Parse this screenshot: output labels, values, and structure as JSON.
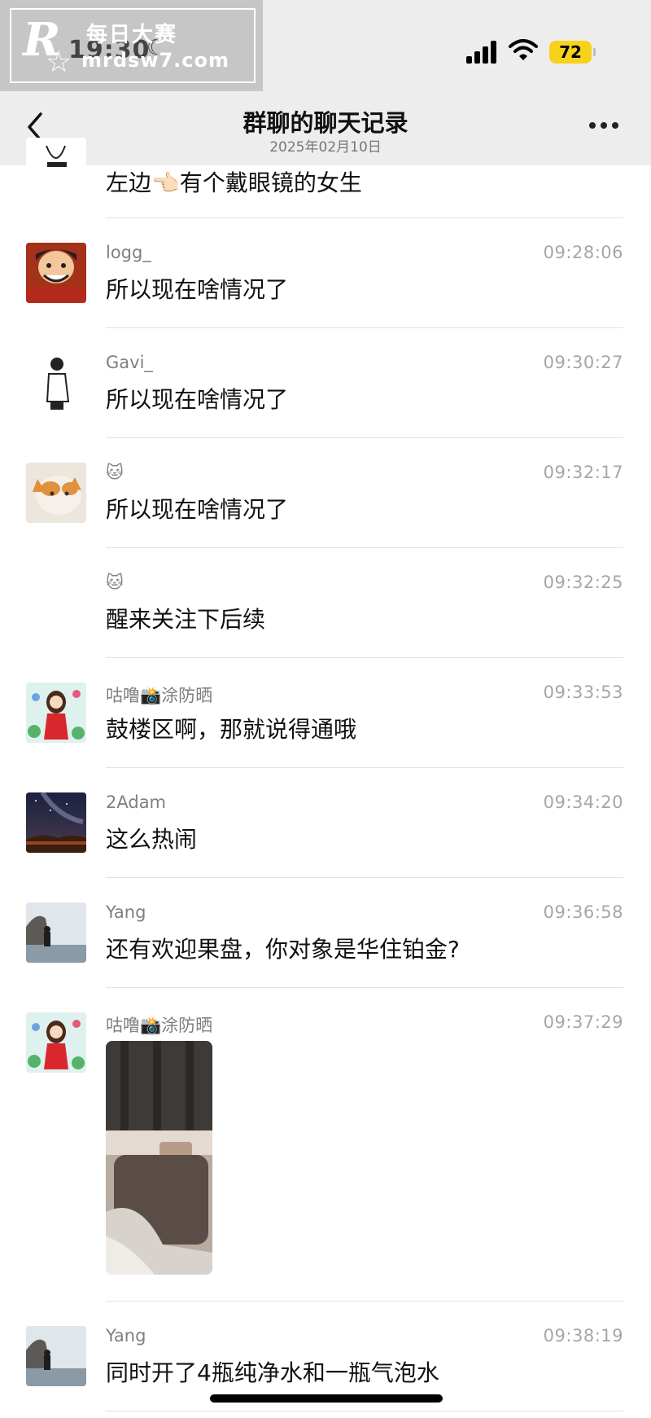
{
  "status_bar": {
    "time": "19:30",
    "battery": "72"
  },
  "header": {
    "title": "群聊的聊天记录",
    "date": "2025年02月10日"
  },
  "watermark": {
    "brand": "R",
    "cn_text": "每日大赛",
    "url": "mrdsw7.com"
  },
  "partial_message": {
    "text": "左边👈🏻有个戴眼镜的女生"
  },
  "messages": [
    {
      "sender": "logg_",
      "time": "09:28:06",
      "text": "所以现在啥情况了"
    },
    {
      "sender": "Gavi_",
      "time": "09:30:27",
      "text": "所以现在啥情况了"
    },
    {
      "sender": "🐱",
      "time": "09:32:17",
      "text": "所以现在啥情况了"
    },
    {
      "sender": "🐱",
      "time": "09:32:25",
      "text": "醒来关注下后续"
    },
    {
      "sender": "咕噜📸涂防晒",
      "time": "09:33:53",
      "text": "鼓楼区啊，那就说得通哦"
    },
    {
      "sender": "2Adam",
      "time": "09:34:20",
      "text": "这么热闹"
    },
    {
      "sender": "Yang",
      "time": "09:36:58",
      "text": "还有欢迎果盘，你对象是华住铂金?"
    },
    {
      "sender": "咕噜📸涂防晒",
      "time": "09:37:29",
      "text": ""
    },
    {
      "sender": "Yang",
      "time": "09:38:19",
      "text": "同时开了4瓶纯净水和一瓶气泡水"
    }
  ],
  "colors": {
    "header_bg": "#ededed",
    "battery": "#f6d21a",
    "divider": "#e2e2e2",
    "time_text": "#a6a6a6"
  }
}
